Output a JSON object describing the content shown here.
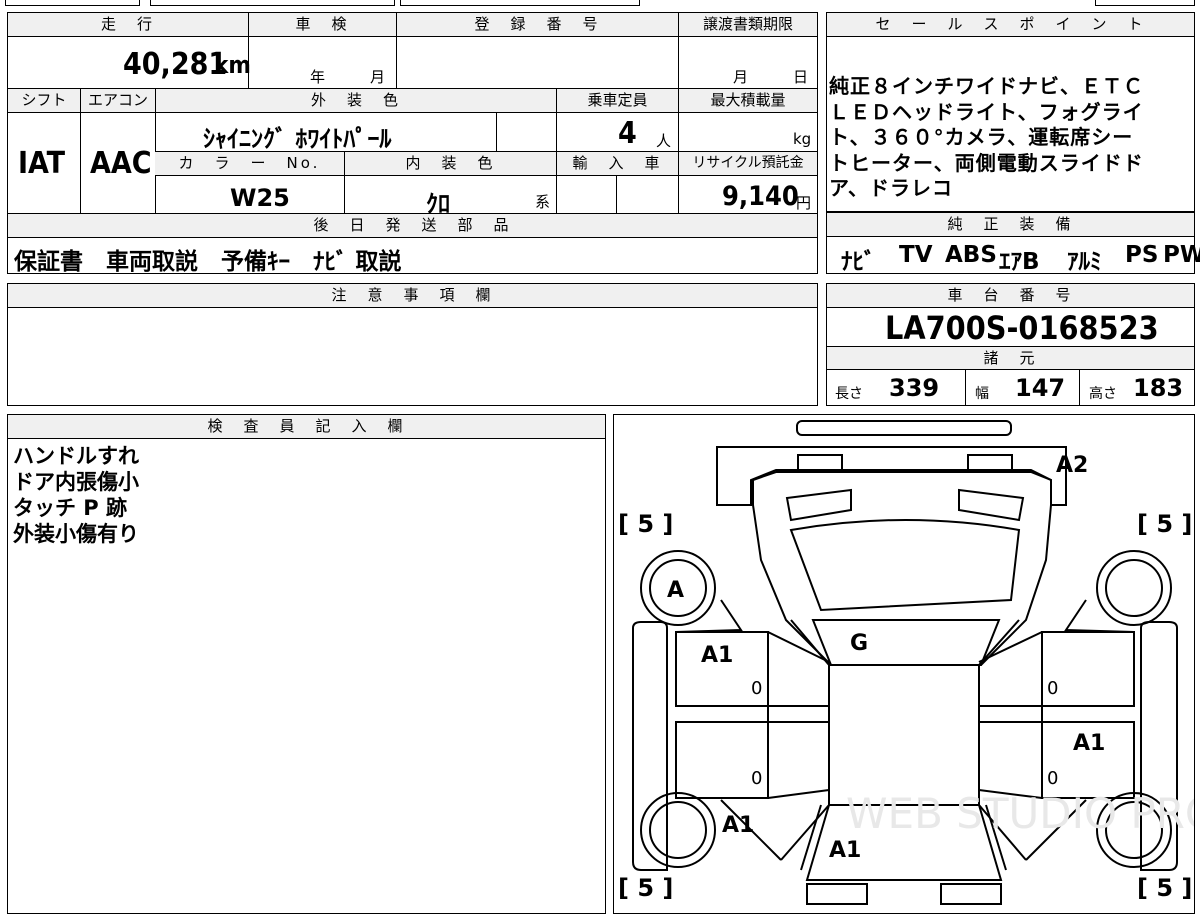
{
  "top_section": {
    "mileage_label": "走　行",
    "mileage_value": "40,281",
    "mileage_unit": "km",
    "shaken_label": "車　検",
    "shaken_year_unit": "年",
    "shaken_month_unit": "月",
    "reg_number_label": "登　録　番　号",
    "transfer_deadline_label": "譲渡書類期限",
    "transfer_month_unit": "月",
    "transfer_day_unit": "日",
    "shift_label": "シフト",
    "shift_value": "IAT",
    "aircon_label": "エアコン",
    "aircon_value": "AAC",
    "exterior_color_label": "外　装　色",
    "exterior_color_value": "ｼｬｲﾆﾝｸﾞ ﾎﾜｲﾄﾊﾟｰﾙ",
    "capacity_label": "乗車定員",
    "capacity_value": "4",
    "capacity_unit": "人",
    "max_load_label": "最大積載量",
    "max_load_unit": "kg",
    "color_no_label": "カ　ラ　ー　No.",
    "color_no_value": "W25",
    "interior_color_label": "内　装　色",
    "interior_color_value": "ｸﾛ",
    "interior_color_suffix": "系",
    "import_label": "輸　入　車",
    "recycle_label": "リサイクル預託金",
    "recycle_value": "9,140",
    "recycle_unit": "円",
    "later_parts_label": "後　日　発　送　部　品",
    "later_parts_value": "保証書　車両取説　予備ｷｰ　ﾅﾋﾞ 取説"
  },
  "sales_points": {
    "label": "セ　ー　ル　ス　ポ　イ　ン　ト",
    "lines": [
      "純正８インチワイドナビ、ＥＴＣ",
      "ＬＥＤヘッドライト、フォグライ",
      "ト、３６０°カメラ、運転席シー",
      "トヒーター、両側電動スライドド",
      "ア、ドラレコ"
    ]
  },
  "equipment": {
    "label": "純　正　装　備",
    "items": [
      "ﾅﾋﾞ",
      "TV",
      "ABS",
      "ｴｱB",
      "ｱﾙﾐ",
      "PS",
      "PW"
    ]
  },
  "notes": {
    "label": "注　意　事　項　欄",
    "text": ""
  },
  "chassis": {
    "label": "車　台　番　号",
    "value": "LA700S-0168523",
    "specs_label": "諸　元",
    "length_label": "長さ",
    "length_value": "339",
    "width_label": "幅",
    "width_value": "147",
    "height_label": "高さ",
    "height_value": "183"
  },
  "inspector": {
    "label": "検　査　員　記　入　欄",
    "lines": [
      "ハンドルすれ",
      "ドア内張傷小",
      "タッチ P 跡",
      "外装小傷有り"
    ]
  },
  "diagram": {
    "tire_fl": "[ 5 ]",
    "tire_fr": "[ 5 ]",
    "tire_rl": "[ 5 ]",
    "tire_rr": "[ 5 ]",
    "mark_front": "A2",
    "mark_fender_l": "A",
    "mark_windshield": "G",
    "mark_door_fl": "A1",
    "mark_door_rr": "A1",
    "mark_rear_fender_l": "A1",
    "mark_rear": "A1",
    "zero": "0",
    "watermark": "WEB STUDIO PRO"
  }
}
